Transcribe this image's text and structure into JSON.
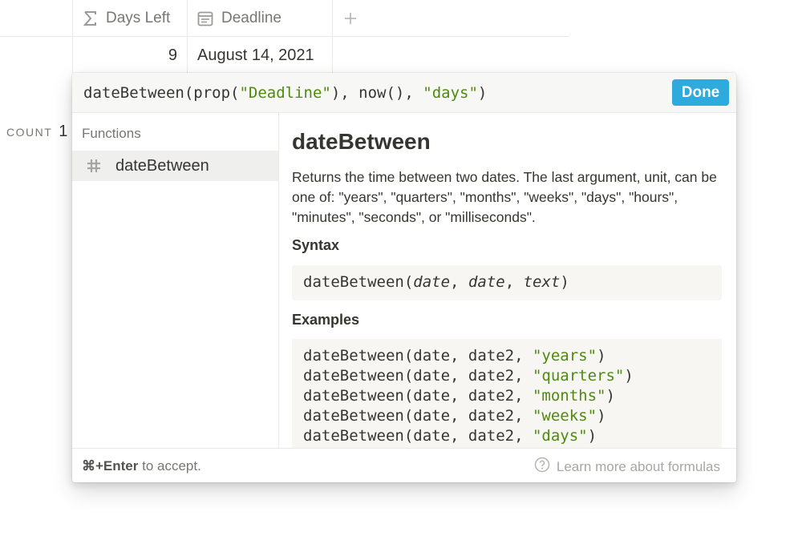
{
  "table": {
    "columns": [
      {
        "label": "Days Left",
        "icon": "sigma-icon"
      },
      {
        "label": "Deadline",
        "icon": "calendar-icon"
      }
    ],
    "add_column_icon": "plus-icon",
    "row": {
      "days_left": "9",
      "deadline": "August 14, 2021"
    },
    "count_label": "COUNT",
    "count_value": "1"
  },
  "formula_editor": {
    "formula_tokens": [
      {
        "text": "dateBetween(prop(",
        "type": "code"
      },
      {
        "text": "\"Deadline\"",
        "type": "string"
      },
      {
        "text": "), now(), ",
        "type": "code"
      },
      {
        "text": "\"days\"",
        "type": "string"
      },
      {
        "text": ")",
        "type": "code"
      }
    ],
    "done_label": "Done",
    "accent_color": "#2eaadc"
  },
  "sidebar": {
    "section_label": "Functions",
    "items": [
      {
        "label": "dateBetween",
        "icon": "hash-icon",
        "selected": true
      }
    ]
  },
  "doc": {
    "title": "dateBetween",
    "description": "Returns the time between two dates. The last argument, unit, can be one of: \"years\", \"quarters\", \"months\", \"weeks\", \"days\", \"hours\", \"minutes\", \"seconds\", or \"milliseconds\".",
    "syntax_heading": "Syntax",
    "syntax": {
      "fn": "dateBetween(",
      "args": [
        "date",
        "date",
        "text"
      ],
      "close": ")"
    },
    "examples_heading": "Examples",
    "examples": [
      {
        "code": "dateBetween(date, date2, ",
        "arg": "\"years\"",
        "close": ")"
      },
      {
        "code": "dateBetween(date, date2, ",
        "arg": "\"quarters\"",
        "close": ")"
      },
      {
        "code": "dateBetween(date, date2, ",
        "arg": "\"months\"",
        "close": ")"
      },
      {
        "code": "dateBetween(date, date2, ",
        "arg": "\"weeks\"",
        "close": ")"
      },
      {
        "code": "dateBetween(date, date2, ",
        "arg": "\"days\"",
        "close": ")"
      }
    ],
    "string_color": "#4f8a10"
  },
  "footer": {
    "shortcut": "⌘+Enter",
    "hint_suffix": " to accept.",
    "help_icon": "question-circle-icon",
    "learn_more": "Learn more about formulas"
  }
}
